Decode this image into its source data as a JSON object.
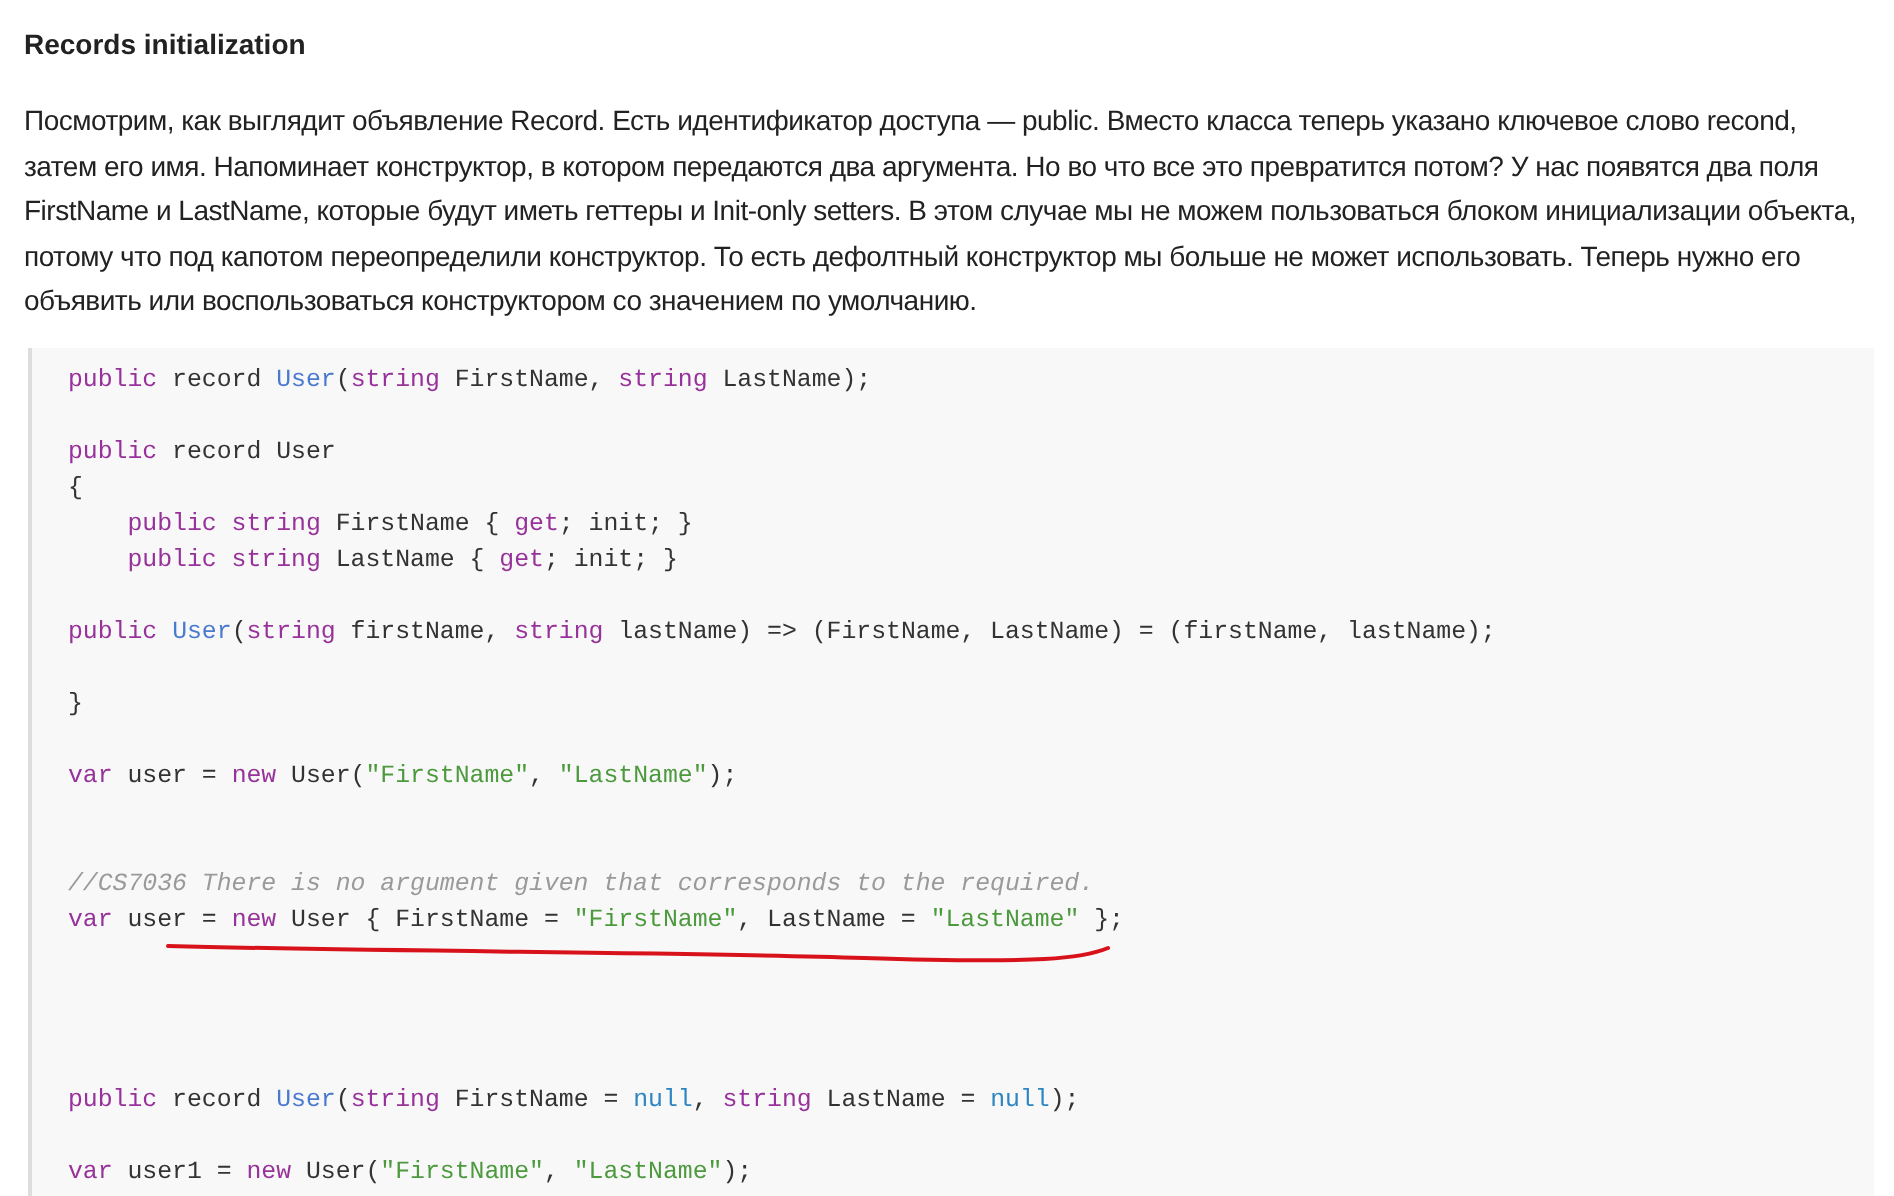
{
  "heading": "Records initialization",
  "paragraph": "Посмотрим, как выглядит объявление Record. Есть идентификатор доступа — public. Вместо класса теперь указано ключевое слово recond, затем его имя. Напоминает конструктор, в котором передаются два аргумента. Но во что все это превратится потом? У нас появятся два поля FirstName и LastName, которые будут иметь геттеры и Init-only setters. В этом случае мы не можем пользоваться блоком инициализации объекта, потому что под капотом переопределили конструктор. То есть дефолтный конструктор мы больше не может использовать. Теперь нужно его объявить или воспользоваться конструктором со значением по умолчанию.",
  "code_groups": [
    {
      "lines": [
        {
          "underlined": false,
          "indented": false,
          "tokens": [
            {
              "kind": "keyword",
              "text": "public"
            },
            {
              "kind": "plain",
              "text": " record "
            },
            {
              "kind": "type",
              "text": "User"
            },
            {
              "kind": "plain",
              "text": "("
            },
            {
              "kind": "keyword",
              "text": "string"
            },
            {
              "kind": "plain",
              "text": " FirstName, "
            },
            {
              "kind": "keyword",
              "text": "string"
            },
            {
              "kind": "plain",
              "text": " LastName);"
            }
          ]
        }
      ]
    },
    {
      "lines": [
        {
          "underlined": false,
          "indented": false,
          "tokens": [
            {
              "kind": "keyword",
              "text": "public"
            },
            {
              "kind": "plain",
              "text": " record User"
            }
          ]
        },
        {
          "underlined": false,
          "indented": false,
          "tokens": [
            {
              "kind": "plain",
              "text": "{"
            }
          ]
        },
        {
          "underlined": false,
          "indented": true,
          "tokens": [
            {
              "kind": "keyword",
              "text": "public string"
            },
            {
              "kind": "plain",
              "text": " FirstName { "
            },
            {
              "kind": "keyword",
              "text": "get"
            },
            {
              "kind": "plain",
              "text": "; init; }"
            }
          ]
        },
        {
          "underlined": false,
          "indented": true,
          "tokens": [
            {
              "kind": "keyword",
              "text": "public string"
            },
            {
              "kind": "plain",
              "text": " LastName { "
            },
            {
              "kind": "keyword",
              "text": "get"
            },
            {
              "kind": "plain",
              "text": "; init; }"
            }
          ]
        }
      ]
    },
    {
      "lines": [
        {
          "underlined": false,
          "indented": false,
          "tokens": [
            {
              "kind": "keyword",
              "text": "public "
            },
            {
              "kind": "type",
              "text": "User"
            },
            {
              "kind": "plain",
              "text": "("
            },
            {
              "kind": "keyword",
              "text": "string"
            },
            {
              "kind": "plain",
              "text": " firstName, "
            },
            {
              "kind": "keyword",
              "text": "string"
            },
            {
              "kind": "plain",
              "text": " lastName) => (FirstName, LastName) = (firstName, lastName);"
            }
          ]
        }
      ]
    },
    {
      "lines": [
        {
          "underlined": false,
          "indented": false,
          "tokens": [
            {
              "kind": "plain",
              "text": "}"
            }
          ]
        }
      ]
    },
    {
      "lines": [
        {
          "underlined": false,
          "indented": false,
          "tokens": [
            {
              "kind": "keyword",
              "text": "var"
            },
            {
              "kind": "plain",
              "text": " user = "
            },
            {
              "kind": "keyword",
              "text": "new"
            },
            {
              "kind": "plain",
              "text": " User("
            },
            {
              "kind": "string",
              "text": "\"FirstName\""
            },
            {
              "kind": "plain",
              "text": ", "
            },
            {
              "kind": "string",
              "text": "\"LastName\""
            },
            {
              "kind": "plain",
              "text": ");"
            }
          ]
        }
      ]
    },
    {
      "lines": [
        {
          "underlined": false,
          "indented": false,
          "tokens": [
            {
              "kind": "comment",
              "text": "//CS7036 There is no argument given that corresponds to the required."
            }
          ]
        },
        {
          "underlined": true,
          "indented": false,
          "tokens": [
            {
              "kind": "keyword",
              "text": "var"
            },
            {
              "kind": "plain",
              "text": " user = "
            },
            {
              "kind": "keyword",
              "text": "new"
            },
            {
              "kind": "plain",
              "text": " User { FirstName = "
            },
            {
              "kind": "string",
              "text": "\"FirstName\""
            },
            {
              "kind": "plain",
              "text": ", LastName = "
            },
            {
              "kind": "string",
              "text": "\"LastName\""
            },
            {
              "kind": "plain",
              "text": " };"
            }
          ]
        }
      ]
    },
    {
      "lines": [
        {
          "underlined": false,
          "indented": false,
          "tokens": [
            {
              "kind": "keyword",
              "text": "public"
            },
            {
              "kind": "plain",
              "text": " record "
            },
            {
              "kind": "type",
              "text": "User"
            },
            {
              "kind": "plain",
              "text": "("
            },
            {
              "kind": "keyword",
              "text": "string"
            },
            {
              "kind": "plain",
              "text": " FirstName = "
            },
            {
              "kind": "literal",
              "text": "null"
            },
            {
              "kind": "plain",
              "text": ", "
            },
            {
              "kind": "keyword",
              "text": "string"
            },
            {
              "kind": "plain",
              "text": " LastName = "
            },
            {
              "kind": "literal",
              "text": "null"
            },
            {
              "kind": "plain",
              "text": ");"
            }
          ]
        }
      ]
    },
    {
      "lines": [
        {
          "underlined": false,
          "indented": false,
          "tokens": [
            {
              "kind": "keyword",
              "text": "var"
            },
            {
              "kind": "plain",
              "text": " user1 = "
            },
            {
              "kind": "keyword",
              "text": "new"
            },
            {
              "kind": "plain",
              "text": " User("
            },
            {
              "kind": "string",
              "text": "\"FirstName\""
            },
            {
              "kind": "plain",
              "text": ", "
            },
            {
              "kind": "string",
              "text": "\"LastName\""
            },
            {
              "kind": "plain",
              "text": ");"
            }
          ]
        }
      ]
    }
  ]
}
